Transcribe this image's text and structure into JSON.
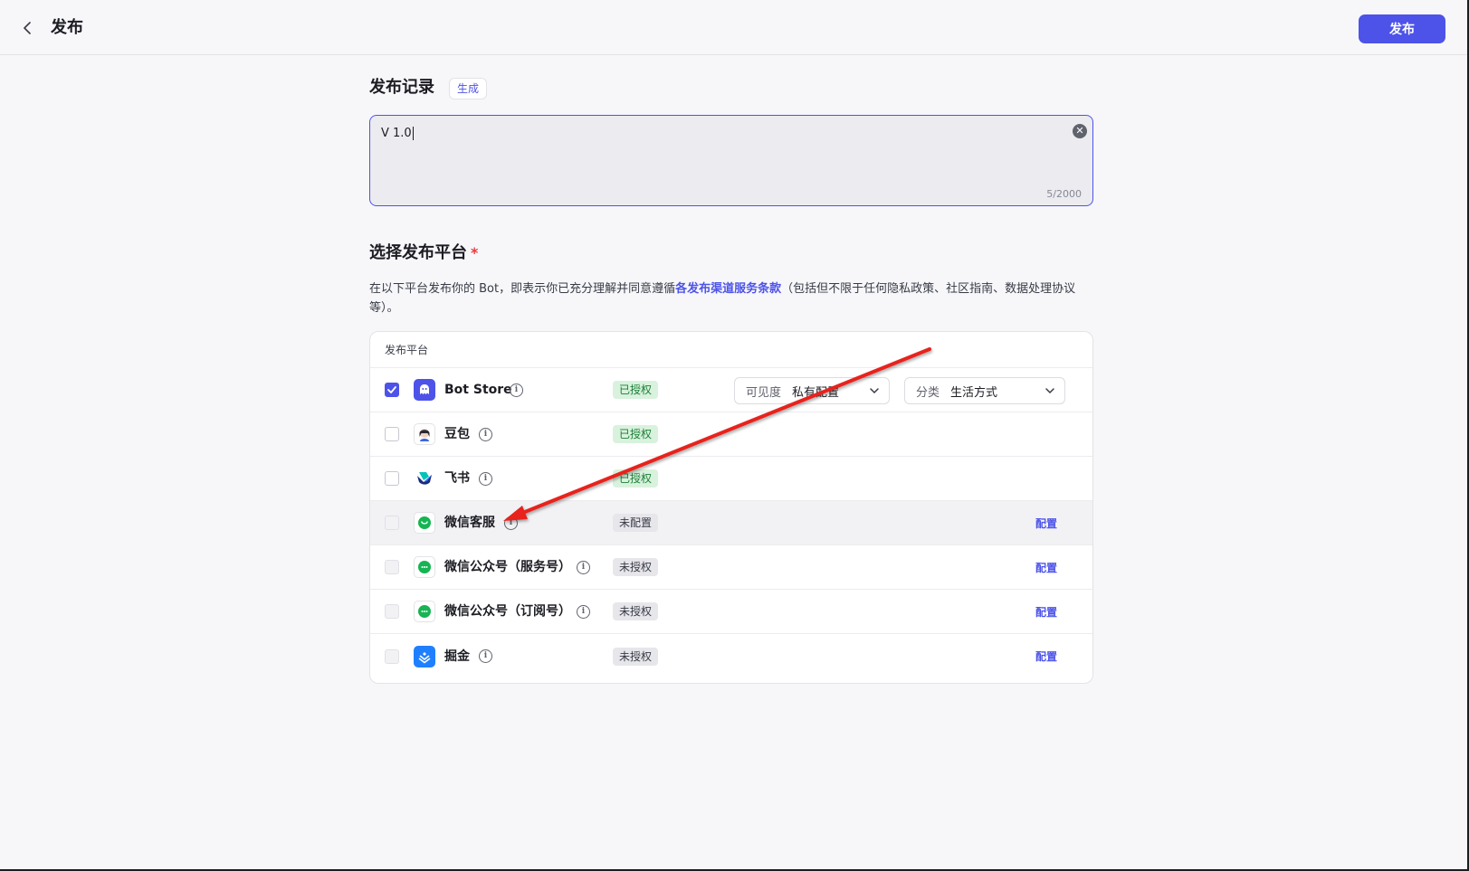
{
  "header": {
    "title": "发布",
    "publish_label": "发布"
  },
  "records": {
    "title": "发布记录",
    "generate_label": "生成",
    "value": "V 1.0",
    "char_count": "5/2000"
  },
  "platforms": {
    "title": "选择发布平台",
    "required_mark": "*",
    "agreement_before": "在以下平台发布你的 Bot，即表示你已充分理解并同意遵循",
    "agreement_link": "各发布渠道服务条款",
    "agreement_after": "（包括但不限于任何隐私政策、社区指南、数据处理协议等）。",
    "table_header": "发布平台",
    "items": [
      {
        "name": "Bot Store",
        "status": "已授权",
        "checked": true
      },
      {
        "name": "豆包",
        "status": "已授权",
        "checked": false
      },
      {
        "name": "飞书",
        "status": "已授权",
        "checked": false
      },
      {
        "name": "微信客服",
        "status": "未配置",
        "config": "配置"
      },
      {
        "name": "微信公众号（服务号）",
        "status": "未授权",
        "config": "配置"
      },
      {
        "name": "微信公众号（订阅号）",
        "status": "未授权",
        "config": "配置"
      },
      {
        "name": "掘金",
        "status": "未授权",
        "config": "配置"
      }
    ],
    "visibility": {
      "label": "可见度",
      "value": "私有配置"
    },
    "category": {
      "label": "分类",
      "value": "生活方式"
    }
  },
  "colors": {
    "accent": "#4d53e8",
    "authorized_bg": "#d9f2dd",
    "annotation_arrow": "#e8221b"
  }
}
